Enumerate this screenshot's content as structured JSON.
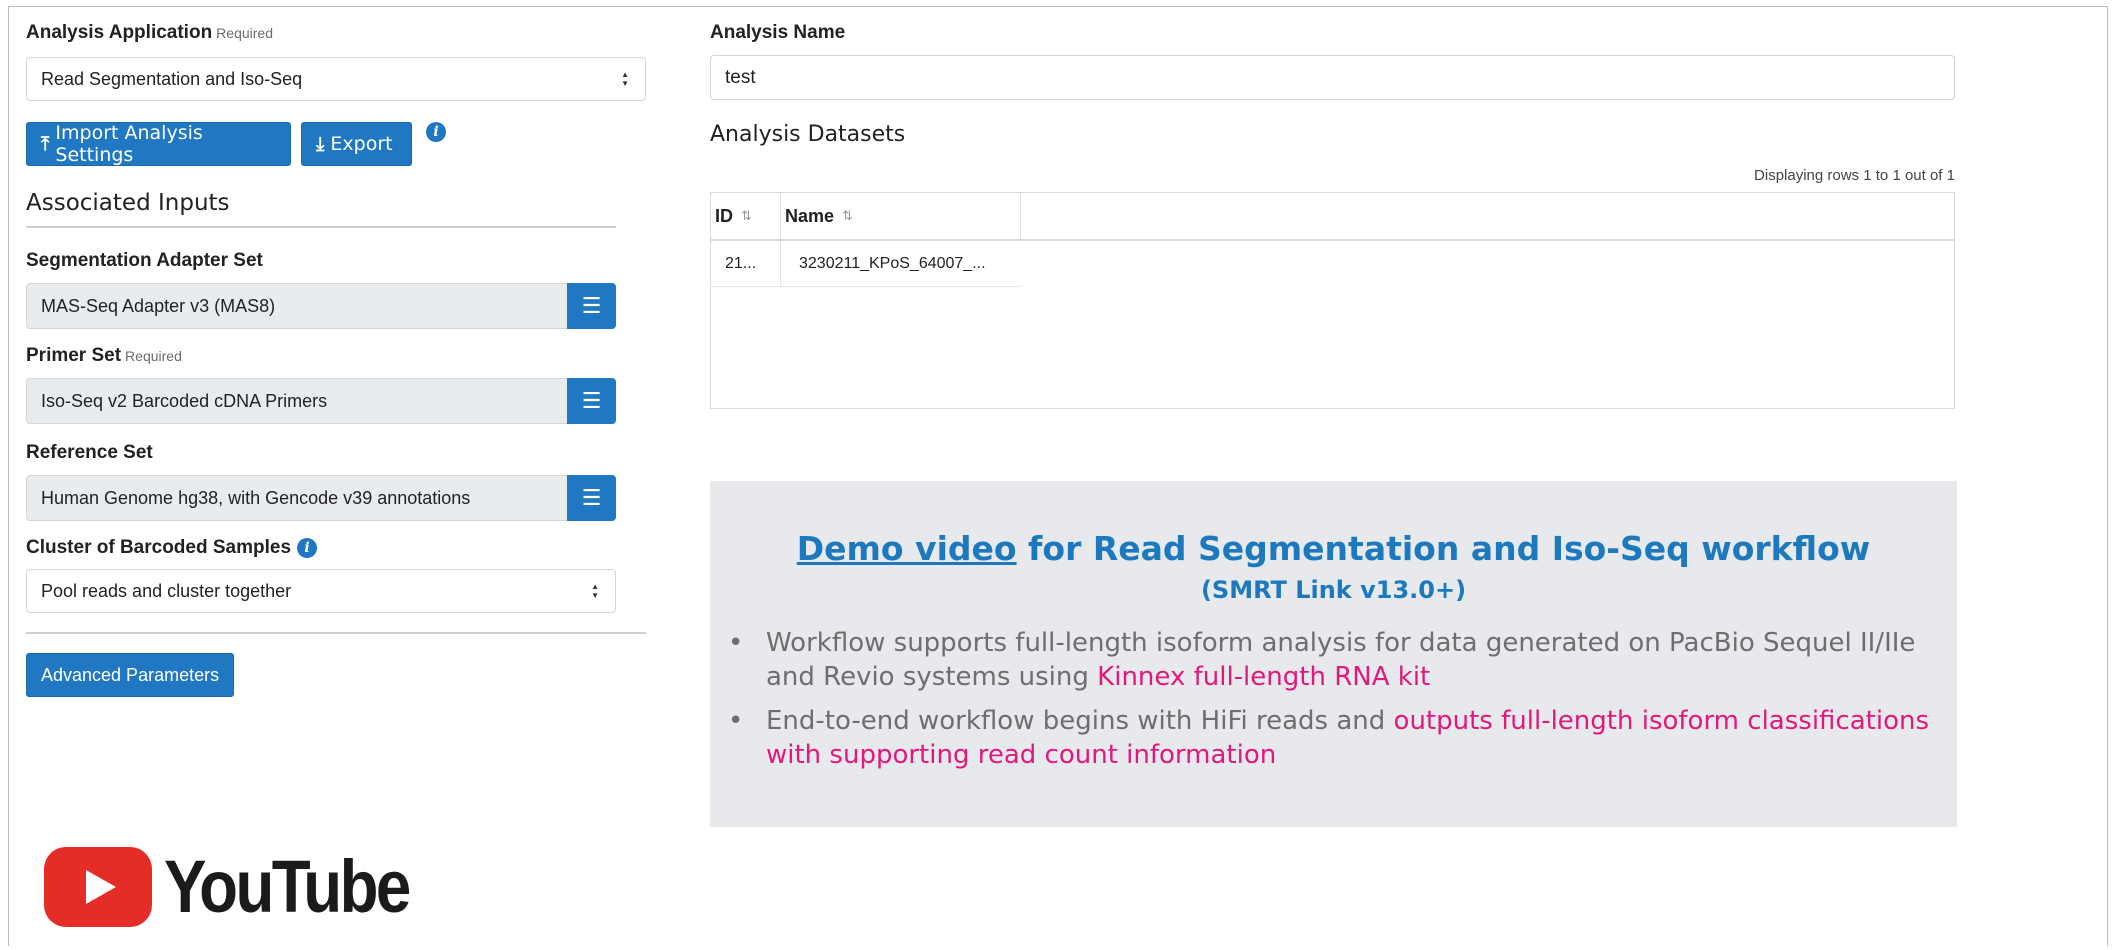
{
  "left": {
    "analysis_application": {
      "label": "Analysis Application",
      "required": "Required",
      "value": "Read Segmentation and Iso-Seq"
    },
    "import_button": "Import Analysis Settings",
    "export_button": "Export",
    "associated_inputs": "Associated Inputs",
    "segmentation": {
      "label": "Segmentation Adapter Set",
      "value": "MAS-Seq Adapter v3 (MAS8)"
    },
    "primer": {
      "label": "Primer Set",
      "required": "Required",
      "value": "Iso-Seq v2 Barcoded cDNA Primers"
    },
    "reference": {
      "label": "Reference Set",
      "value": "Human Genome hg38, with Gencode v39 annotations"
    },
    "cluster": {
      "label": "Cluster of Barcoded Samples",
      "value": "Pool reads and cluster together"
    },
    "advanced_button": "Advanced Parameters"
  },
  "right": {
    "analysis_name": {
      "label": "Analysis Name",
      "value": "test"
    },
    "datasets_title": "Analysis Datasets",
    "displaying": "Displaying rows 1 to 1 out of 1",
    "table": {
      "columns": [
        "ID",
        "Name"
      ],
      "rows": [
        {
          "id": "21...",
          "name": "3230211_KPoS_64007_..."
        }
      ]
    }
  },
  "callout": {
    "title_link": "Demo video",
    "title_rest": " for Read Segmentation and Iso-Seq workflow",
    "subtitle": "(SMRT Link v13.0+)",
    "bullet1_a": "Workflow supports full-length isoform analysis for data generated on PacBio Sequel II/IIe and Revio systems using ",
    "bullet1_b": "Kinnex full-length RNA kit",
    "bullet2_a": "End-to-end workflow begins with HiFi reads and ",
    "bullet2_b": "outputs full-length isoform classifications with supporting read count information",
    "bullet_char": "•"
  },
  "logo": {
    "text": "YouTube"
  },
  "colors": {
    "accent": "#1f78c1",
    "highlight": "#e2197b",
    "callout_bg": "#e7e9ec",
    "youtube_red": "#e52d27"
  }
}
